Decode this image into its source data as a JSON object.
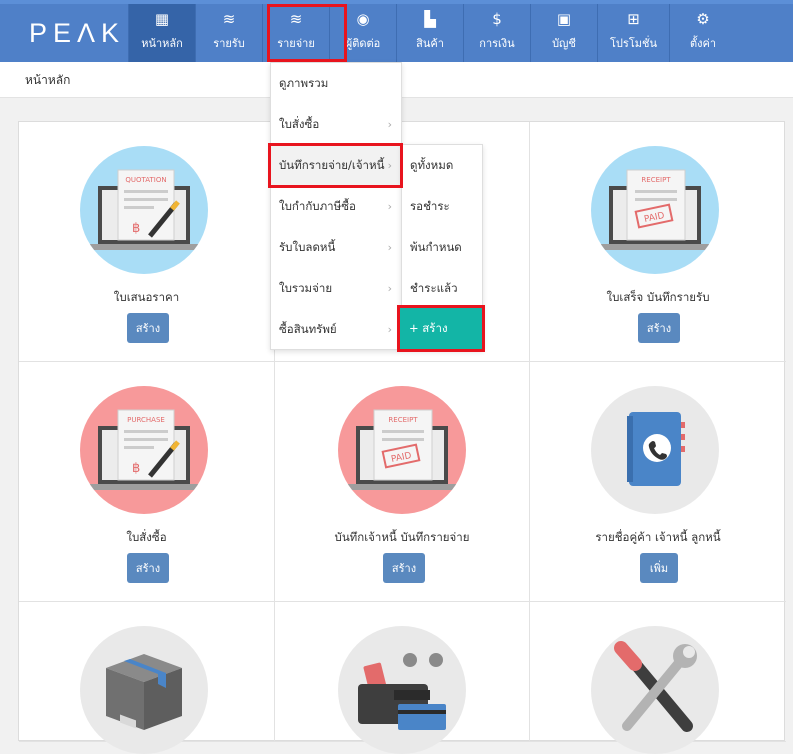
{
  "logo": "PEΛK",
  "nav": [
    {
      "label": "หน้าหลัก",
      "icon": "grid-icon"
    },
    {
      "label": "รายรับ",
      "icon": "coins-icon"
    },
    {
      "label": "รายจ่าย",
      "icon": "coins-icon"
    },
    {
      "label": "ผู้ติดต่อ",
      "icon": "user-icon"
    },
    {
      "label": "สินค้า",
      "icon": "boxes-icon"
    },
    {
      "label": "การเงิน",
      "icon": "money-bag-icon"
    },
    {
      "label": "บัญชี",
      "icon": "briefcase-icon"
    },
    {
      "label": "โปรโมชั่น",
      "icon": "gift-icon"
    },
    {
      "label": "ตั้งค่า",
      "icon": "gear-icon"
    }
  ],
  "breadcrumb": "หน้าหลัก",
  "dropdown": {
    "items": [
      "ดูภาพรวม",
      "ใบสั่งซื้อ",
      "บันทึกรายจ่าย/เจ้าหนี้",
      "ใบกำกับภาษีซื้อ",
      "รับใบลดหนี้",
      "ใบรวมจ่าย",
      "ซื้อสินทรัพย์"
    ],
    "arrow": "›"
  },
  "submenu": {
    "items": [
      "ดูทั้งหมด",
      "รอชำระ",
      "พ้นกำหนด",
      "ชำระแล้ว"
    ],
    "create": "+ สร้าง"
  },
  "cards": {
    "quotation": {
      "label": "ใบเสนอราคา",
      "button": "สร้าง",
      "art_text": "QUOTATION",
      "currency": "฿"
    },
    "receipt": {
      "label": "ใบเสร็จ บันทึกรายรับ",
      "button": "สร้าง",
      "art_text": "RECEIPT",
      "stamp": "PAID"
    },
    "purchase": {
      "label": "ใบสั่งซื้อ",
      "button": "สร้าง",
      "art_text": "PURCHASE",
      "currency": "฿"
    },
    "expense": {
      "label": "บันทึกเจ้าหนี้ บันทึกรายจ่าย",
      "button": "สร้าง",
      "art_text": "RECEIPT",
      "stamp": "PAID"
    },
    "contacts": {
      "label": "รายชื่อคู่ค้า เจ้าหนี้ ลูกหนี้",
      "button": "เพิ่ม"
    }
  }
}
